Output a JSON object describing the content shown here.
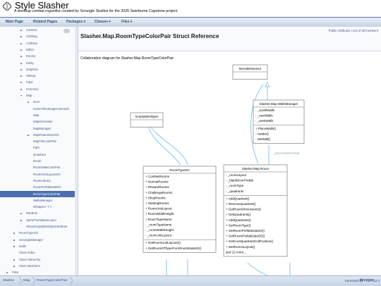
{
  "project": {
    "name": "Style Slasher",
    "brief": "A dresdup combat roguelike created by Scrungle Studios for the 2025 Swinburne Capstone project."
  },
  "navbar": {
    "items": [
      "Main Page",
      "Related Pages",
      "Packages ▾",
      "Classes ▾",
      "Files ▾"
    ]
  },
  "tree": [
    {
      "label": "Camera",
      "depth": 2,
      "arrow": "▶"
    },
    {
      "label": "Clothing",
      "depth": 2,
      "arrow": "▶"
    },
    {
      "label": "Collision",
      "depth": 2,
      "arrow": "▶"
    },
    {
      "label": "Editor",
      "depth": 2,
      "arrow": "▶"
    },
    {
      "label": "Enemy",
      "depth": 2,
      "arrow": "▶"
    },
    {
      "label": "Entity",
      "depth": 2,
      "arrow": "▶"
    },
    {
      "label": "Graphics",
      "depth": 2,
      "arrow": "▶"
    },
    {
      "label": "Hitstop",
      "depth": 2,
      "arrow": "▶"
    },
    {
      "label": "Input",
      "depth": 2,
      "arrow": "▶"
    },
    {
      "label": "Inventory",
      "depth": 2,
      "arrow": "▶"
    },
    {
      "label": "Map",
      "depth": 2,
      "arrow": "▼"
    },
    {
      "label": "Door",
      "depth": 3,
      "arrow": "▶"
    },
    {
      "label": "GameTilesImageColorsSO",
      "depth": 3,
      "arrow": ""
    },
    {
      "label": "Map",
      "depth": 3,
      "arrow": ""
    },
    {
      "label": "MapGenerator",
      "depth": 3,
      "arrow": ""
    },
    {
      "label": "MapManager",
      "depth": 3,
      "arrow": ""
    },
    {
      "label": "MapParametersSO",
      "depth": 3,
      "arrow": "▶"
    },
    {
      "label": "MapTileColorPair",
      "depth": 3,
      "arrow": ""
    },
    {
      "label": "Path",
      "depth": 3,
      "arrow": ""
    },
    {
      "label": "Quadrant",
      "depth": 3,
      "arrow": ""
    },
    {
      "label": "Room",
      "depth": 3,
      "arrow": ""
    },
    {
      "label": "RoomDataColorPair",
      "depth": 3,
      "arrow": ""
    },
    {
      "label": "RoomGridLayoutSO",
      "depth": 3,
      "arrow": ""
    },
    {
      "label": "RoomLibrary",
      "depth": 3,
      "arrow": ""
    },
    {
      "label": "RoomPrefabDataSO",
      "depth": 3,
      "arrow": ""
    },
    {
      "label": "RoomTypeColorPair",
      "depth": 3,
      "arrow": "",
      "selected": true
    },
    {
      "label": "WallsManager",
      "depth": 3,
      "arrow": ""
    },
    {
      "label": "Wrapper< T >",
      "depth": 3,
      "arrow": ""
    },
    {
      "label": "Random",
      "depth": 2,
      "arrow": "▶"
    },
    {
      "label": "SpriteTranslationLayer",
      "depth": 2,
      "arrow": "▶"
    },
    {
      "label": "ShowScriptableObjectAttribute",
      "depth": 2,
      "arrow": ""
    },
    {
      "label": "RoomTypeSO",
      "depth": 1,
      "arrow": "▶"
    },
    {
      "label": "ScrungleManager",
      "depth": 1,
      "arrow": "▶"
    },
    {
      "label": "testD",
      "depth": 1,
      "arrow": "▶"
    },
    {
      "label": "Class Index",
      "depth": 1,
      "arrow": ""
    },
    {
      "label": "Class Hierarchy",
      "depth": 1,
      "arrow": "▶"
    },
    {
      "label": "Class Members",
      "depth": 1,
      "arrow": "▶"
    },
    {
      "label": "Files",
      "depth": 0,
      "arrow": "▶"
    }
  ],
  "content": {
    "summary": "Public Attributes | List of all members",
    "title": "Slasher.Map.RoomTypeColorPair Struct Reference",
    "collab_text": "Collaboration diagram for Slasher.Map.RoomTypeColorPair:"
  },
  "diagram": {
    "mono": {
      "title": "MonoBehaviour"
    },
    "walls": {
      "title": "Slasher.Map.WallsManager",
      "attrs": [
        "- _southWalls",
        "- _eastWalls",
        "- _westWalls"
      ],
      "methods": [
        "+ PlaceWalls()",
        "- Awake()",
        "- SetWall()"
      ]
    },
    "so": {
      "title": "ScriptableObject"
    },
    "roomtype": {
      "title": "RoomTypeSO",
      "attrs": [
        "+ CombatRooms",
        "+ NormalRooms",
        "+ RewardRooms",
        "+ ChallengeRooms",
        "+ ShopRooms",
        "+ StartingRooms",
        "+ RoomUnitLayout",
        "+ RoomWidthHeight",
        "+ RoomTypeName",
        "- _roomTypeName",
        "- _roomWidthHeight",
        "- _roomUnitLayout"
      ],
      "methods": [
        "+ GetRoomUnitLayouts()",
        "+ GetRoomOfTypeFromRoomDataSO()"
      ]
    },
    "room": {
      "title": "Slasher.Map.Room",
      "attrs": [
        "- _roomLayout",
        "- _blankDoorPrefab",
        "- _roomType",
        "- _quadrants"
      ],
      "methods": [
        "+ AddQuadrant()",
        "+ RemoveQuadrant()",
        "+ GetRoomDimensions()",
        "+ GetQuadrants()",
        "+ AddQuadrants()",
        "+ SetRoomType()",
        "+ SetRoomPrefabDataSO()",
        "+ GetRoomPrefabDataSO()",
        "+ GetCoreQuadrantGridPosition()",
        "+ SetRoomsLayout()",
        "and 12 more..."
      ]
    },
    "edge_label": "_placeWallsPrefab"
  },
  "footer": {
    "crumbs": [
      "Slasher",
      "Map",
      "RoomTypeColorPair"
    ],
    "generated": "Generated by",
    "doxygen": "doxygen",
    "version": "1.13.2"
  },
  "colors": {
    "nav_text": "#3d578c",
    "selected_bg": "#4d6fb0",
    "edge": "#63b8ff"
  }
}
